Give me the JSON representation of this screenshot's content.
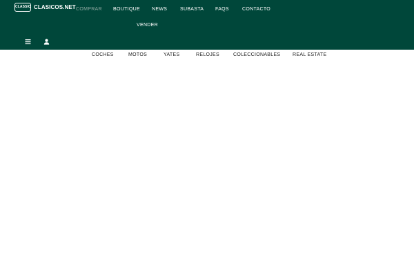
{
  "brand": {
    "badge_text": "CLASSIC",
    "name": "CLASICOS.NET"
  },
  "nav": {
    "comprar": "COMPRAR",
    "boutique": "BOUTIQUE",
    "news": "NEWS",
    "subasta": "SUBASTA",
    "faqs": "FAQS",
    "contacto": "CONTACTO",
    "vender": "VENDER"
  },
  "icons": {
    "menu": "hamburger-menu-icon",
    "account": "user-icon"
  },
  "categories": {
    "coches": "COCHES",
    "motos": "MOTOS",
    "yates": "YATES",
    "relojes": "RELOJES",
    "coleccionables": "COLECCIONABLES",
    "real_estate": "REAL ESTATE"
  },
  "colors": {
    "header_bg": "#00473a",
    "active_nav": "#8fa8a1",
    "nav_text": "#ffffff",
    "subnav_text": "#222222"
  }
}
